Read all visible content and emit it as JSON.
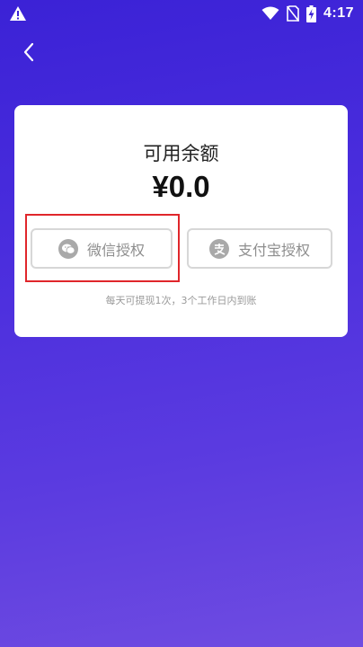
{
  "status_bar": {
    "time": "4:17",
    "icons": [
      "warning-icon",
      "wifi-icon",
      "no-sim-icon",
      "battery-charging-icon"
    ]
  },
  "nav": {
    "back_icon": "chevron-left-icon"
  },
  "card": {
    "balance_label": "可用余额",
    "balance_amount": "¥0.0",
    "wechat_button": {
      "label": "微信授权",
      "icon": "wechat-icon"
    },
    "alipay_button": {
      "label": "支付宝授权",
      "icon": "alipay-icon"
    },
    "note": "每天可提现1次，3个工作日内到账"
  },
  "colors": {
    "background_top": "#3b22d6",
    "background_bottom": "#6f4ce1",
    "highlight": "#e0262b",
    "button_border": "#d7d7d7",
    "button_text": "#8e8e8e"
  }
}
